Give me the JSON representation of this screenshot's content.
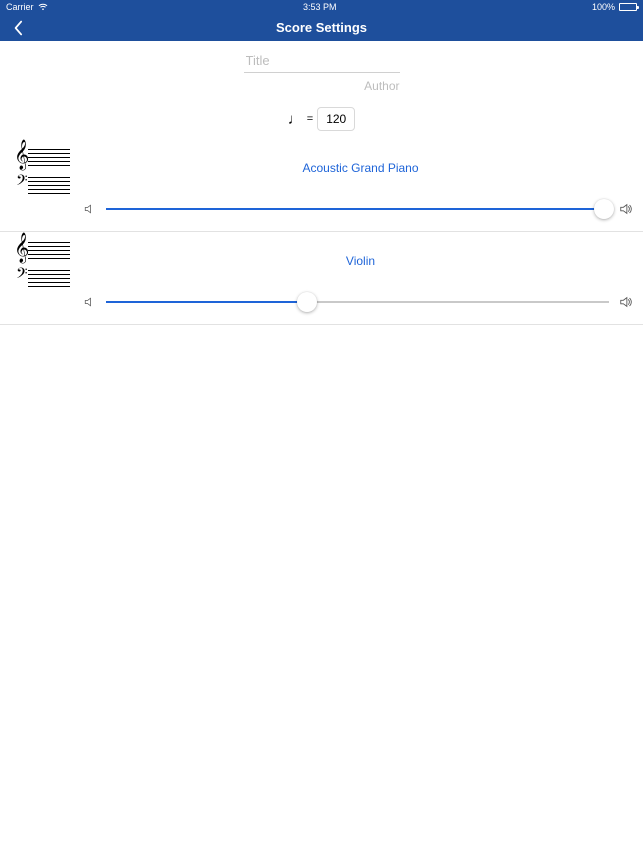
{
  "status": {
    "carrier": "Carrier",
    "time": "3:53 PM",
    "battery_pct": "100%"
  },
  "nav": {
    "title": "Score Settings"
  },
  "meta": {
    "title_placeholder": "Title",
    "title_value": "",
    "author_label": "Author"
  },
  "tempo": {
    "equals": "=",
    "value": "120"
  },
  "instruments": [
    {
      "name": "Acoustic Grand Piano",
      "volume_pct": 99
    },
    {
      "name": "Violin",
      "volume_pct": 40
    }
  ]
}
